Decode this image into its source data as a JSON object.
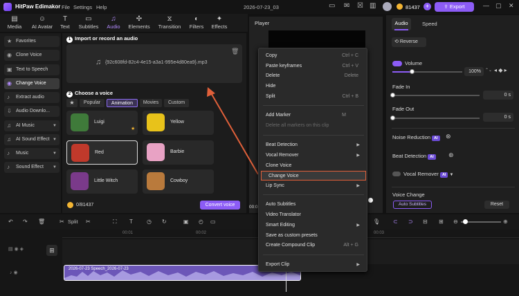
{
  "app": {
    "name": "HitPaw Edimakor",
    "menu": [
      "File",
      "Settings",
      "Help"
    ],
    "project": "2026-07-23_03",
    "credits": "81437",
    "export_label": "Export"
  },
  "toolbar": {
    "tabs": [
      {
        "label": "Media",
        "icon": "media-icon"
      },
      {
        "label": "AI Avatar",
        "icon": "ai-avatar-icon"
      },
      {
        "label": "Text",
        "icon": "text-icon"
      },
      {
        "label": "Subtitles",
        "icon": "subtitles-icon"
      },
      {
        "label": "Audio",
        "icon": "audio-icon"
      },
      {
        "label": "Elements",
        "icon": "elements-icon"
      },
      {
        "label": "Transition",
        "icon": "transition-icon"
      },
      {
        "label": "Filters",
        "icon": "filters-icon"
      },
      {
        "label": "Effects",
        "icon": "effects-icon"
      }
    ],
    "active": "Audio"
  },
  "sidebar": {
    "items": [
      {
        "label": "Favorites"
      },
      {
        "label": "Clone Voice"
      },
      {
        "label": "Text to Speech"
      },
      {
        "label": "Change Voice"
      },
      {
        "label": "Extract audio"
      },
      {
        "label": "Audio Downlo..."
      },
      {
        "label": "AI Music"
      },
      {
        "label": "AI Sound Effect"
      },
      {
        "label": "Music"
      },
      {
        "label": "Sound Effect"
      }
    ]
  },
  "import": {
    "title": "Import or record an audio",
    "step": "1",
    "file": "{92c608fd-82c4-4e15-a3a1-995e4d80ea9}.mp3"
  },
  "voices": {
    "title": "Choose a voice",
    "step": "2",
    "filters": [
      "Popular",
      "Animation",
      "Movies",
      "Custom"
    ],
    "active_filter": "Animation",
    "items": [
      {
        "name": "Luigi",
        "color": "#3f7a3a"
      },
      {
        "name": "Yellow",
        "color": "#e8c21a"
      },
      {
        "name": "Red",
        "color": "#c0392b"
      },
      {
        "name": "Barbie",
        "color": "#e8a2c4"
      },
      {
        "name": "Little Witch",
        "color": "#7a3a8a"
      },
      {
        "name": "Cowboy",
        "color": "#b97a3c"
      }
    ],
    "credits": "0/81437",
    "convert_label": "Convert voice"
  },
  "player": {
    "title": "Player",
    "time": "00:0"
  },
  "rightpanel": {
    "tabs": [
      "Audio",
      "Speed"
    ],
    "reverse_label": "Reverse",
    "volume_label": "Volume",
    "volume_value": "100%",
    "fadein_label": "Fade In",
    "fadein_value": "0",
    "fadeout_label": "Fade Out",
    "fadeout_value": "0",
    "unit": "s",
    "noise_label": "Noise Reduction",
    "beat_label": "Beat Detection",
    "vocal_label": "Vocal Remover",
    "ai_badge": "AI",
    "voice_change_label": "Voice Change",
    "auto_subtitles_label": "Auto Subtitles",
    "reset_label": "Reset"
  },
  "timeline": {
    "split_label": "Split",
    "ticks": [
      "00:01",
      "00:02",
      "00:03"
    ],
    "clip_label": "2026-07-23 Speech_2026-07-23"
  },
  "context_menu": {
    "items": [
      {
        "label": "Copy",
        "shortcut": "Ctrl + C"
      },
      {
        "label": "Paste keyframes",
        "shortcut": "Ctrl + V"
      },
      {
        "label": "Delete",
        "shortcut": "Delete"
      },
      {
        "label": "Hide",
        "shortcut": ""
      },
      {
        "label": "Split",
        "shortcut": "Ctrl + B"
      },
      {
        "label": "Add Marker",
        "shortcut": "M"
      },
      {
        "label": "Delete all markers on this clip",
        "shortcut": ""
      },
      {
        "label": "Beat Detection",
        "shortcut": ""
      },
      {
        "label": "Vocal Remover",
        "shortcut": ""
      },
      {
        "label": "Clone Voice",
        "shortcut": ""
      },
      {
        "label": "Change Voice",
        "shortcut": ""
      },
      {
        "label": "Lip Sync",
        "shortcut": ""
      },
      {
        "label": "Auto Subtitles",
        "shortcut": ""
      },
      {
        "label": "Video Translator",
        "shortcut": ""
      },
      {
        "label": "Smart Editing",
        "shortcut": ""
      },
      {
        "label": "Save as custom presets",
        "shortcut": ""
      },
      {
        "label": "Create Compound Clip",
        "shortcut": "Alt + G"
      },
      {
        "label": "Export Clip",
        "shortcut": ""
      }
    ]
  },
  "colors": {
    "accent": "#8c5cf6",
    "highlight_border": "#e0603a",
    "arrow": "#e0603a"
  }
}
